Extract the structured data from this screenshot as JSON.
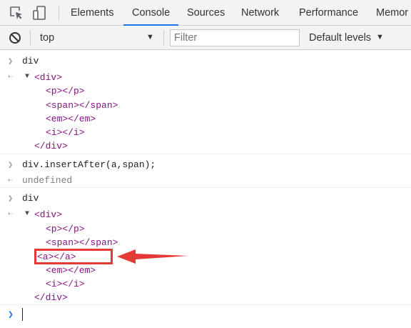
{
  "tabs": [
    {
      "label": "Elements",
      "active": false
    },
    {
      "label": "Console",
      "active": true
    },
    {
      "label": "Sources",
      "active": false
    },
    {
      "label": "Network",
      "active": false
    },
    {
      "label": "Performance",
      "active": false
    },
    {
      "label": "Memor",
      "active": false
    }
  ],
  "toolbar": {
    "context": "top",
    "filter_placeholder": "Filter",
    "filter_value": "",
    "levels": "Default levels"
  },
  "console": {
    "entries": [
      {
        "input": "div",
        "output": {
          "open": "<div>",
          "children": [
            "<p></p>",
            "<span></span>",
            "<em></em>",
            "<i></i>"
          ],
          "close": "</div>"
        }
      },
      {
        "input": "div.insertAfter(a,span);",
        "result": "undefined"
      },
      {
        "input": "div",
        "output": {
          "open": "<div>",
          "children": [
            "<p></p>",
            "<span></span>",
            "<a></a>",
            "<em></em>",
            "<i></i>"
          ],
          "close": "</div>"
        }
      }
    ],
    "prompt_value": ""
  },
  "colors": {
    "tag": "#881280",
    "prompt": "#1a73e8",
    "annotation": "#e53935",
    "active_tab_underline": "#1a73e8"
  },
  "icons": [
    "inspect-element-icon",
    "device-toggle-icon",
    "clear-console-icon",
    "dropdown-caret-icon",
    "expand-triangle-icon",
    "input-chevron-icon",
    "output-arrow-icon",
    "annotation-arrow-icon"
  ]
}
